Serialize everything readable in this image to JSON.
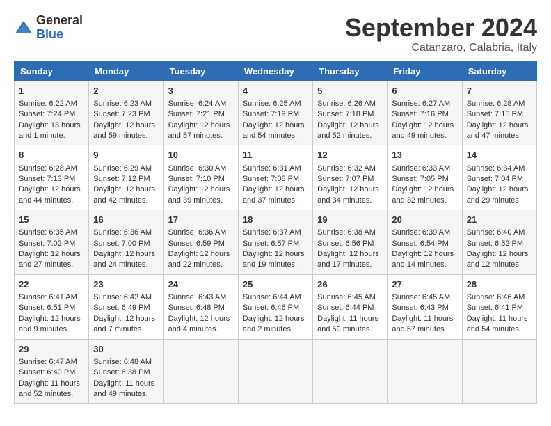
{
  "logo": {
    "general": "General",
    "blue": "Blue"
  },
  "title": "September 2024",
  "location": "Catanzaro, Calabria, Italy",
  "days": [
    "Sunday",
    "Monday",
    "Tuesday",
    "Wednesday",
    "Thursday",
    "Friday",
    "Saturday"
  ],
  "weeks": [
    [
      {
        "day": "1",
        "sunrise": "6:22 AM",
        "sunset": "7:24 PM",
        "daylight": "13 hours and 1 minute."
      },
      {
        "day": "2",
        "sunrise": "6:23 AM",
        "sunset": "7:23 PM",
        "daylight": "12 hours and 59 minutes."
      },
      {
        "day": "3",
        "sunrise": "6:24 AM",
        "sunset": "7:21 PM",
        "daylight": "12 hours and 57 minutes."
      },
      {
        "day": "4",
        "sunrise": "6:25 AM",
        "sunset": "7:19 PM",
        "daylight": "12 hours and 54 minutes."
      },
      {
        "day": "5",
        "sunrise": "6:26 AM",
        "sunset": "7:18 PM",
        "daylight": "12 hours and 52 minutes."
      },
      {
        "day": "6",
        "sunrise": "6:27 AM",
        "sunset": "7:16 PM",
        "daylight": "12 hours and 49 minutes."
      },
      {
        "day": "7",
        "sunrise": "6:28 AM",
        "sunset": "7:15 PM",
        "daylight": "12 hours and 47 minutes."
      }
    ],
    [
      {
        "day": "8",
        "sunrise": "6:28 AM",
        "sunset": "7:13 PM",
        "daylight": "12 hours and 44 minutes."
      },
      {
        "day": "9",
        "sunrise": "6:29 AM",
        "sunset": "7:12 PM",
        "daylight": "12 hours and 42 minutes."
      },
      {
        "day": "10",
        "sunrise": "6:30 AM",
        "sunset": "7:10 PM",
        "daylight": "12 hours and 39 minutes."
      },
      {
        "day": "11",
        "sunrise": "6:31 AM",
        "sunset": "7:08 PM",
        "daylight": "12 hours and 37 minutes."
      },
      {
        "day": "12",
        "sunrise": "6:32 AM",
        "sunset": "7:07 PM",
        "daylight": "12 hours and 34 minutes."
      },
      {
        "day": "13",
        "sunrise": "6:33 AM",
        "sunset": "7:05 PM",
        "daylight": "12 hours and 32 minutes."
      },
      {
        "day": "14",
        "sunrise": "6:34 AM",
        "sunset": "7:04 PM",
        "daylight": "12 hours and 29 minutes."
      }
    ],
    [
      {
        "day": "15",
        "sunrise": "6:35 AM",
        "sunset": "7:02 PM",
        "daylight": "12 hours and 27 minutes."
      },
      {
        "day": "16",
        "sunrise": "6:36 AM",
        "sunset": "7:00 PM",
        "daylight": "12 hours and 24 minutes."
      },
      {
        "day": "17",
        "sunrise": "6:36 AM",
        "sunset": "6:59 PM",
        "daylight": "12 hours and 22 minutes."
      },
      {
        "day": "18",
        "sunrise": "6:37 AM",
        "sunset": "6:57 PM",
        "daylight": "12 hours and 19 minutes."
      },
      {
        "day": "19",
        "sunrise": "6:38 AM",
        "sunset": "6:56 PM",
        "daylight": "12 hours and 17 minutes."
      },
      {
        "day": "20",
        "sunrise": "6:39 AM",
        "sunset": "6:54 PM",
        "daylight": "12 hours and 14 minutes."
      },
      {
        "day": "21",
        "sunrise": "6:40 AM",
        "sunset": "6:52 PM",
        "daylight": "12 hours and 12 minutes."
      }
    ],
    [
      {
        "day": "22",
        "sunrise": "6:41 AM",
        "sunset": "6:51 PM",
        "daylight": "12 hours and 9 minutes."
      },
      {
        "day": "23",
        "sunrise": "6:42 AM",
        "sunset": "6:49 PM",
        "daylight": "12 hours and 7 minutes."
      },
      {
        "day": "24",
        "sunrise": "6:43 AM",
        "sunset": "6:48 PM",
        "daylight": "12 hours and 4 minutes."
      },
      {
        "day": "25",
        "sunrise": "6:44 AM",
        "sunset": "6:46 PM",
        "daylight": "12 hours and 2 minutes."
      },
      {
        "day": "26",
        "sunrise": "6:45 AM",
        "sunset": "6:44 PM",
        "daylight": "11 hours and 59 minutes."
      },
      {
        "day": "27",
        "sunrise": "6:45 AM",
        "sunset": "6:43 PM",
        "daylight": "11 hours and 57 minutes."
      },
      {
        "day": "28",
        "sunrise": "6:46 AM",
        "sunset": "6:41 PM",
        "daylight": "11 hours and 54 minutes."
      }
    ],
    [
      {
        "day": "29",
        "sunrise": "6:47 AM",
        "sunset": "6:40 PM",
        "daylight": "11 hours and 52 minutes."
      },
      {
        "day": "30",
        "sunrise": "6:48 AM",
        "sunset": "6:38 PM",
        "daylight": "11 hours and 49 minutes."
      },
      null,
      null,
      null,
      null,
      null
    ]
  ],
  "labels": {
    "sunrise": "Sunrise:",
    "sunset": "Sunset:",
    "daylight": "Daylight:"
  }
}
